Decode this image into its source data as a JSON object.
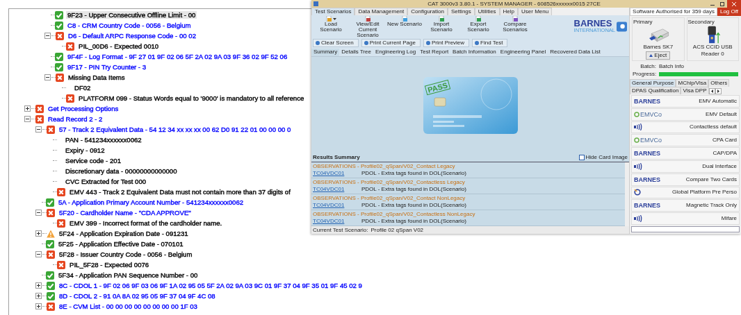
{
  "tree": {
    "continued_items": [
      {
        "label": "9F23 - Upper Consecutive Offline Limit - 00",
        "kind": "pass",
        "color": "#000000",
        "selected": true
      },
      {
        "label": "C8 - CRM Country Code - 0056 - Belgium",
        "kind": "pass",
        "color": "#0000ff",
        "selected": false
      },
      {
        "label": "D6 - Default ARPC Response Code - 00 02",
        "kind": "fail",
        "color": "#0000ff",
        "selected": false,
        "expanded": true,
        "children": [
          {
            "label": "PIL_00D6 - Expected 0010",
            "kind": "fail",
            "color": "#000000",
            "selected": false
          }
        ]
      },
      {
        "label": "9F4F - Log Format - 9F 27 01 9F 02 06 5F 2A 02 9A 03 9F 36 02 9F 52 06",
        "kind": "pass",
        "color": "#0000ff",
        "selected": false
      },
      {
        "label": "9F17 - PIN Try Counter - 3",
        "kind": "pass",
        "color": "#0000ff",
        "selected": false
      },
      {
        "label": "Missing Data Items",
        "kind": "fail",
        "color": "#000000",
        "selected": false,
        "expanded": true,
        "children": [
          {
            "label": "DF02",
            "kind": "none",
            "color": "#000000",
            "selected": false
          },
          {
            "label": "PLATFORM 099 - Status Words equal to '9000' is mandatory to all reference",
            "kind": "fail",
            "color": "#000000",
            "selected": false
          }
        ]
      }
    ],
    "items": [
      {
        "label": "Get Processing Options",
        "kind": "fail",
        "color": "#0000ff",
        "selected": false,
        "expanded": false
      },
      {
        "label": "Read Record 2 - 2",
        "kind": "fail",
        "color": "#0000ff",
        "selected": false,
        "expanded": true,
        "children": [
          {
            "label": "57 - Track 2 Equivalent Data - 54 12 34 xx xx xx 00 62 D0 91 22 01 00 00 00 0",
            "kind": "fail",
            "color": "#0000ff",
            "selected": false,
            "expanded": true,
            "children": [
              {
                "label": "PAN - 541234xxxxxx0062",
                "kind": "none",
                "color": "#000000",
                "selected": false
              },
              {
                "label": "Expiry - 0912",
                "kind": "none",
                "color": "#000000",
                "selected": false
              },
              {
                "label": "Service code - 201",
                "kind": "none",
                "color": "#000000",
                "selected": false
              },
              {
                "label": "Discretionary data - 00000000000000",
                "kind": "none",
                "color": "#000000",
                "selected": false
              },
              {
                "label": "CVC Extracted for Test 000",
                "kind": "none",
                "color": "#000000",
                "selected": false
              },
              {
                "label": "EMV 443 - Track 2 Equivalent Data must not contain more than 37 digits of",
                "kind": "fail",
                "color": "#000000",
                "selected": false
              }
            ]
          },
          {
            "label": "5A - Application Primary Account Number - 541234xxxxxx0062",
            "kind": "pass",
            "color": "#0000ff",
            "selected": false
          },
          {
            "label": "5F20 - Cardholder Name - \"CDA APPROVE\"",
            "kind": "fail",
            "color": "#0000ff",
            "selected": false,
            "expanded": true,
            "children": [
              {
                "label": "EMV 399 - Incorrect format of the cardholder name.",
                "kind": "fail",
                "color": "#000000",
                "selected": false
              }
            ]
          },
          {
            "label": "5F24 - Application Expiration Date - 091231",
            "kind": "warning",
            "color": "#000000",
            "selected": false,
            "expanded": false
          },
          {
            "label": "5F25 - Application Effective Date - 070101",
            "kind": "pass",
            "color": "#000000",
            "selected": false
          },
          {
            "label": "5F28 - Issuer Country Code - 0056 - Belgium",
            "kind": "fail",
            "color": "#000000",
            "selected": false,
            "expanded": true,
            "children": [
              {
                "label": "PIL_5F28 - Expected 0076",
                "kind": "fail",
                "color": "#000000",
                "selected": false
              }
            ]
          },
          {
            "label": "5F34 - Application PAN Sequence Number - 00",
            "kind": "pass",
            "color": "#000000",
            "selected": false
          },
          {
            "label": "8C - CDOL 1 - 9F 02 06 9F 03 06 9F 1A 02 95 05 5F 2A 02 9A 03 9C 01 9F 37 04 9F 35 01 9F 45 02 9",
            "kind": "pass",
            "color": "#0000ff",
            "selected": false,
            "expanded": false
          },
          {
            "label": "8D - CDOL 2 - 91 0A 8A 02 95 05 9F 37 04 9F 4C 08",
            "kind": "pass",
            "color": "#0000ff",
            "selected": false,
            "expanded": false
          },
          {
            "label": "8E - CVM List - 00 00 00 00 00 00 00 00 1F 03",
            "kind": "fail",
            "color": "#0000ff",
            "selected": false,
            "expanded": false
          }
        ]
      }
    ]
  },
  "window": {
    "title": "CAT 3000v3 3.80.1 - SYSTEM MANAGER - 608526xxxxxx0015 27CE",
    "menu_tabs": [
      {
        "label": "Test Scenarios",
        "selected": true
      },
      {
        "label": "Data Management",
        "selected": false
      },
      {
        "label": "Configuration",
        "selected": false
      },
      {
        "label": "Settings",
        "selected": false
      },
      {
        "label": "Utilities",
        "selected": false
      },
      {
        "label": "Help",
        "selected": false
      },
      {
        "label": "User Menu",
        "selected": false
      }
    ],
    "license": "Software Authorised for 359 days",
    "log_off": "Log Off",
    "ribbon": [
      {
        "label": "Load Scenario",
        "dropdown": true
      },
      {
        "label": "View/Edit Current Scenario",
        "dropdown": false
      },
      {
        "label": "New Scenario",
        "dropdown": false
      },
      {
        "label": "Import Scenario",
        "dropdown": false
      },
      {
        "label": "Export Scenario",
        "dropdown": false
      },
      {
        "label": "Compare Scenarios",
        "dropdown": false
      }
    ],
    "logo": {
      "name": "BARNES",
      "subtitle": "INTERNATIONAL"
    },
    "actions": [
      "Clear Screen",
      "Print Current Page",
      "Print Preview",
      "Find Test"
    ],
    "view_tabs": [
      {
        "label": "Summary",
        "selected": true
      },
      {
        "label": "Details Tree",
        "selected": false
      },
      {
        "label": "Engineering Log",
        "selected": false
      },
      {
        "label": "Test Report",
        "selected": false
      },
      {
        "label": "Batch Information",
        "selected": false
      },
      {
        "label": "Engineering Panel",
        "selected": false
      },
      {
        "label": "Recovered Data List",
        "selected": false
      }
    ],
    "card": {
      "stamp": "PASS"
    },
    "results": {
      "title": "Results Summary",
      "hide_card_image": {
        "label": "Hide Card Image",
        "checked": false
      },
      "entries": [
        {
          "title": "OBSERVATIONS - Profile02_qSpan/V02_Contact Legacy",
          "link": "TC04VDC01",
          "detail": "PDOL - Extra tags found in DOL(Scenario)"
        },
        {
          "title": "OBSERVATIONS - Profile02_qSpan/V02_Contactless Legacy",
          "link": "TC04VDC01",
          "detail": "PDOL - Extra tags found in DOL(Scenario)"
        },
        {
          "title": "OBSERVATIONS - Profile02_qSpan/V02_Contact NonLegacy",
          "link": "TC04VDC01",
          "detail": "PDOL - Extra tags found in DOL(Scenario)"
        },
        {
          "title": "OBSERVATIONS - Profile02_qSpan/V02_Contactless NonLegacy",
          "link": "TC04VDC01",
          "detail": "PDOL - Extra tags found in DOL(Scenario)"
        }
      ]
    },
    "status_bar": {
      "label": "Current Test Scenario:",
      "value": "Profile 02 qSpan V02"
    },
    "readers": {
      "primary": {
        "heading": "Primary",
        "name": "Barnes SK7",
        "button": "Eject"
      },
      "secondary": {
        "heading": "Secondary",
        "name": "ACS CCID USB Reader 0"
      }
    },
    "batch": {
      "label": "Batch:",
      "value": "Batch Info"
    },
    "progress": {
      "label": "Progress:",
      "level": 1
    },
    "scenario_tabs": [
      {
        "label": "General Purpose",
        "selected": true
      },
      {
        "label": "MChip/Visa",
        "selected": false
      },
      {
        "label": "Others",
        "selected": false
      },
      {
        "label": "DPAS Qualification",
        "selected": false
      },
      {
        "label": "Visa DPP",
        "selected": false
      }
    ],
    "scenarios": [
      {
        "kind": "barnes",
        "logo": "BARNES",
        "label": "EMV Automatic"
      },
      {
        "kind": "emvco",
        "logo": "EMVCo",
        "label": "EMV Default"
      },
      {
        "kind": "contactless",
        "label": "Contactless default"
      },
      {
        "kind": "emvco",
        "logo": "EMVCo",
        "label": "CPA Card"
      },
      {
        "kind": "barnes",
        "logo": "BARNES",
        "label": "CAP/DPA"
      },
      {
        "kind": "contactless",
        "label": "Dual Interface"
      },
      {
        "kind": "barnes",
        "logo": "BARNES",
        "label": "Compare Two Cards"
      },
      {
        "kind": "globalplatform",
        "label": "Global Platform Pre Perso"
      },
      {
        "kind": "barnes",
        "logo": "BARNES",
        "label": "Magnetic Track Only"
      },
      {
        "kind": "contactless",
        "label": "Mifare"
      }
    ]
  }
}
